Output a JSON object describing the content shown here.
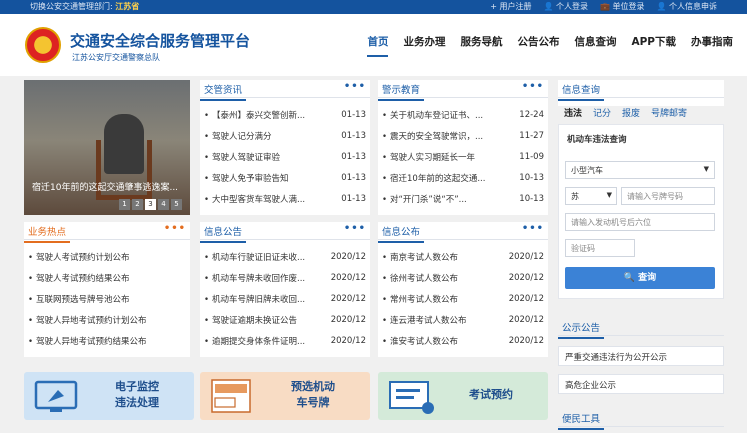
{
  "topbar": {
    "dept_prefix": "切换公安交通管理部门:",
    "dept_value": "江苏省",
    "links": [
      "+ 用户注册",
      "个人登录",
      "单位登录",
      "个人信息申诉"
    ]
  },
  "header": {
    "title": "交通安全综合服务管理平台",
    "subtitle": "江苏公安厅交通警察总队",
    "nav": [
      "首页",
      "业务办理",
      "服务导航",
      "公告公布",
      "信息查询",
      "APP下载",
      "办事指南"
    ],
    "active_nav": "首页"
  },
  "slider": {
    "caption": "宿迁10年前的这起交通肇事逃逸案...",
    "pages": [
      "1",
      "2",
      "3",
      "4",
      "5"
    ],
    "active_page": "3"
  },
  "jgzx": {
    "title": "交管资讯",
    "more": "•••",
    "items": [
      {
        "text": "【泰州】泰兴交警创新...",
        "date": "01-13"
      },
      {
        "text": "驾驶人记分满分",
        "date": "01-13"
      },
      {
        "text": "驾驶人驾驶证审验",
        "date": "01-13"
      },
      {
        "text": "驾驶人免予审验告知",
        "date": "01-13"
      },
      {
        "text": "大中型客货车驾驶人满...",
        "date": "01-13"
      }
    ]
  },
  "jsjy": {
    "title": "警示教育",
    "more": "•••",
    "items": [
      {
        "text": "关于机动车登记证书、...",
        "date": "12-24"
      },
      {
        "text": "震天的安全驾驶常识，...",
        "date": "11-27"
      },
      {
        "text": "驾驶人实习期延长一年",
        "date": "11-09"
      },
      {
        "text": "宿迁10年前的这起交通...",
        "date": "10-13"
      },
      {
        "text": "对“开门杀”说“不”...",
        "date": "10-13"
      }
    ]
  },
  "ywrd": {
    "title": "业务热点",
    "more": "•••",
    "items": [
      "驾驶人考试预约计划公布",
      "驾驶人考试预约结果公布",
      "互联网预选号牌号池公布",
      "驾驶人异地考试预约计划公布",
      "驾驶人异地考试预约结果公布"
    ]
  },
  "xxgg": {
    "title": "信息公告",
    "more": "•••",
    "items": [
      {
        "text": "机动车行驶证旧证未收...",
        "date": "2020/12"
      },
      {
        "text": "机动车号牌未收回作废...",
        "date": "2020/12"
      },
      {
        "text": "机动车号牌旧牌未收回...",
        "date": "2020/12"
      },
      {
        "text": "驾驶证逾期未换证公告",
        "date": "2020/12"
      },
      {
        "text": "逾期提交身体条件证明...",
        "date": "2020/12"
      }
    ]
  },
  "xxgb": {
    "title": "信息公布",
    "more": "•••",
    "items": [
      {
        "text": "南京考试人数公布",
        "date": "2020/12"
      },
      {
        "text": "徐州考试人数公布",
        "date": "2020/12"
      },
      {
        "text": "常州考试人数公布",
        "date": "2020/12"
      },
      {
        "text": "连云港考试人数公布",
        "date": "2020/12"
      },
      {
        "text": "淮安考试人数公布",
        "date": "2020/12"
      }
    ]
  },
  "query": {
    "title": "信息查询",
    "tabs": [
      "违法",
      "记分",
      "报废",
      "号牌邮寄"
    ],
    "active_tab": "违法",
    "subtitle": "机动车违法查询",
    "vehicle_type": "小型汽车",
    "province": "苏",
    "plate_placeholder": "请输入号牌号码",
    "engine_placeholder": "请输入发动机号后六位",
    "captcha_placeholder": "验证码",
    "button": "查询"
  },
  "announce": {
    "title": "公示公告",
    "items": [
      "严重交通违法行为公开公示",
      "高危企业公示"
    ]
  },
  "tools": {
    "title": "便民工具"
  },
  "tiles": [
    {
      "line1": "电子监控",
      "line2": "违法处理"
    },
    {
      "line1": "预选机动",
      "line2": "车号牌"
    },
    {
      "line1": "考试预约",
      "line2": ""
    }
  ],
  "colors": {
    "brand_blue": "#1e5fa8",
    "accent_orange": "#e36d1f",
    "topbar_bg": "#14539e"
  }
}
